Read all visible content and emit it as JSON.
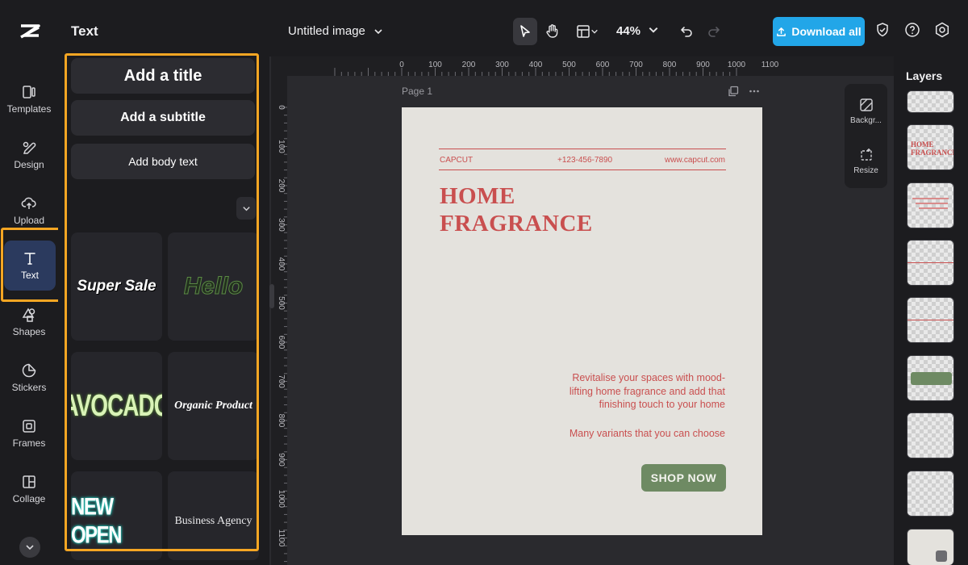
{
  "panel": {
    "title": "Text",
    "add_title": "Add a title",
    "add_subtitle": "Add a subtitle",
    "add_body": "Add body text",
    "presets": [
      "Super Sale",
      "Hello",
      "AVOCADO",
      "Organic Product",
      "NEW OPEN",
      "Business Agency"
    ]
  },
  "rail": {
    "items": [
      {
        "label": "Templates",
        "icon": "templates-icon"
      },
      {
        "label": "Design",
        "icon": "design-icon"
      },
      {
        "label": "Upload",
        "icon": "upload-icon"
      },
      {
        "label": "Text",
        "icon": "text-icon"
      },
      {
        "label": "Shapes",
        "icon": "shapes-icon"
      },
      {
        "label": "Stickers",
        "icon": "stickers-icon"
      },
      {
        "label": "Frames",
        "icon": "frames-icon"
      },
      {
        "label": "Collage",
        "icon": "collage-icon"
      }
    ]
  },
  "topbar": {
    "doc_title": "Untitled image",
    "zoom": "44%",
    "download_label": "Download all"
  },
  "ruler": {
    "top_ticks": [
      "0",
      "100",
      "200",
      "300",
      "400",
      "500",
      "600",
      "700",
      "800",
      "900",
      "1000",
      "1100"
    ],
    "left_ticks": [
      "0",
      "100",
      "200",
      "300",
      "400",
      "500",
      "600",
      "700",
      "800",
      "900",
      "1000",
      "1100"
    ]
  },
  "canvas": {
    "page_label": "Page 1",
    "brand": "CAPCUT",
    "phone": "+123-456-7890",
    "website": "www.capcut.com",
    "headline_line1": "HOME",
    "headline_line2": "FRAGRANCE",
    "body": "Revitalise your spaces with mood-lifting home fragrance and add that finishing touch to your home",
    "body2": "Many variants that you can choose",
    "cta": "SHOP NOW"
  },
  "side_tools": {
    "background_label": "Backgr...",
    "resize_label": "Resize"
  },
  "layers": {
    "title": "Layers",
    "thumb_title_line1": "HOME",
    "thumb_title_line2": "FRAGRANCE"
  },
  "colors": {
    "accent": "#22a6e8",
    "highlight": "#f5a623",
    "brand_red": "#c94f4f",
    "cta_green": "#6e8a63",
    "page_bg": "#e4e2dd"
  }
}
